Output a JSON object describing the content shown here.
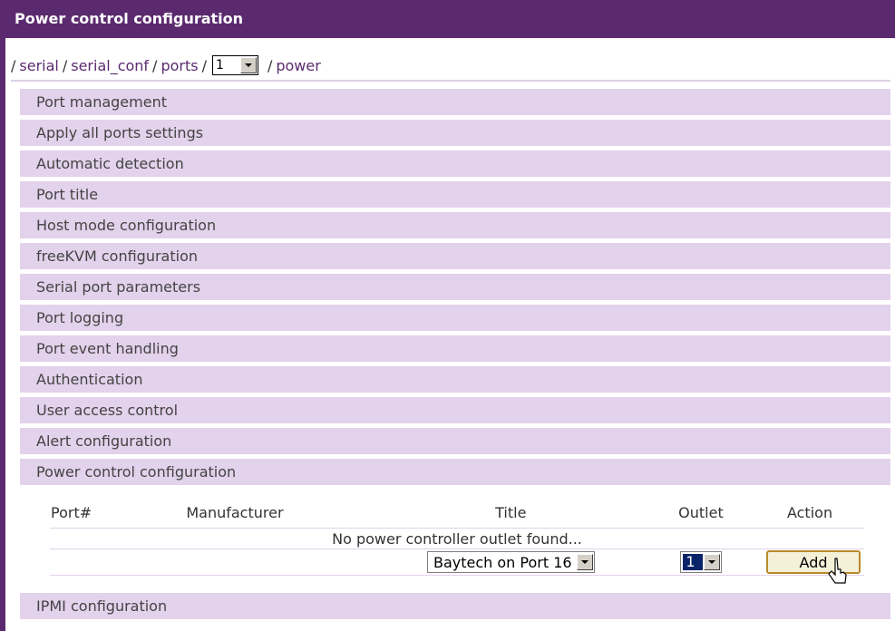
{
  "header": {
    "title": "Power control configuration"
  },
  "breadcrumb": {
    "items": [
      "serial",
      "serial_conf",
      "ports"
    ],
    "port_select_value": "1",
    "last": "power",
    "separator": "/"
  },
  "menu": {
    "items": [
      "Port management",
      "Apply all ports settings",
      "Automatic detection",
      "Port title",
      "Host mode configuration",
      "freeKVM configuration",
      "Serial port parameters",
      "Port logging",
      "Port event handling",
      "Authentication",
      "User access control",
      "Alert configuration",
      "Power control configuration"
    ],
    "after": "IPMI configuration"
  },
  "power_table": {
    "columns": [
      "Port#",
      "Manufacturer",
      "Title",
      "Outlet",
      "Action"
    ],
    "empty_message": "No power controller outlet found...",
    "add_row": {
      "title_select": "Baytech on Port 16",
      "outlet_select": "1",
      "add_button": "Add"
    }
  },
  "colors": {
    "header_bg": "#5b2a6e",
    "menu_item_bg": "#e3d2eb",
    "link": "#5b2a6e",
    "button_border": "#b88a2a"
  }
}
